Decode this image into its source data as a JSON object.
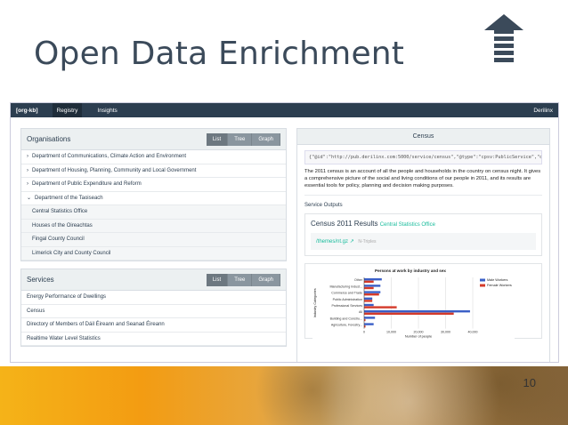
{
  "slide": {
    "title": "Open Data Enrichment",
    "page_number": "10",
    "icon": "arrow-up-icon"
  },
  "navbar": {
    "brand": "[org-kb]",
    "items": [
      "Registry",
      "Insights"
    ],
    "user": "Derilinx"
  },
  "organisations": {
    "title": "Organisations",
    "buttons": [
      "List",
      "Tree",
      "Graph"
    ],
    "items": [
      {
        "label": "Department of Communications, Climate Action and Environment",
        "chev": "›"
      },
      {
        "label": "Department of Housing, Planning, Community and Local Government",
        "chev": "›"
      },
      {
        "label": "Department of Public Expenditure and Reform",
        "chev": "›"
      },
      {
        "label": "Department of the Taoiseach",
        "chev": "⌄"
      },
      {
        "label": "Central Statistics Office",
        "chev": ""
      },
      {
        "label": "Houses of the Oireachtas",
        "chev": ""
      },
      {
        "label": "Fingal County Council",
        "chev": ""
      },
      {
        "label": "Limerick City and County Council",
        "chev": ""
      }
    ]
  },
  "services": {
    "title": "Services",
    "buttons": [
      "List",
      "Tree",
      "Graph"
    ],
    "items": [
      "Energy Performance of Dwellings",
      "Census",
      "Directory of Members of Dáil Éireann and Seanad Éireann",
      "Realtime Water Level Statistics"
    ]
  },
  "census": {
    "title": "Census",
    "code": "{\"@id\":\"http://pub.derilinx.com:5000/service/census\",\"@type\":\"cpsv:PublicService\",\"descri",
    "description": "The 2011 census is an account of all the people and households in the country on census night. It gives a comprehensive picture of the social and living conditions of our people in 2011, and its results are essential tools for policy, planning and decision making purposes.",
    "outputs_label": "Service Outputs",
    "output_title": "Census 2011 Results",
    "output_publisher": "Central Statistics Office",
    "output_link": "/themes/nt.gz",
    "output_link_note": "N-Triples"
  },
  "chart_data": {
    "type": "bar",
    "title": "Persons at work by industry and sex",
    "xlabel": "Number of people",
    "ylabel": "Industry Categories",
    "categories": [
      "Other",
      "Manufacturing Indust...",
      "Commerce and Trade",
      "Public Administration",
      "Professional Services",
      "All",
      "Building and Constru...",
      "Agriculture, Forestry..."
    ],
    "series": [
      {
        "name": "Male Workers",
        "color": "#3a5fc7",
        "values": [
          6500,
          6000,
          6000,
          3000,
          3500,
          39000,
          4000,
          3500
        ]
      },
      {
        "name": "Female Workers",
        "color": "#d43a2a",
        "values": [
          3500,
          3500,
          5500,
          3000,
          12000,
          33000,
          500,
          500
        ]
      }
    ],
    "xlim": [
      0,
      40000
    ],
    "xticks": [
      "0",
      "10,000",
      "20,000",
      "30,000",
      "40,000"
    ]
  }
}
